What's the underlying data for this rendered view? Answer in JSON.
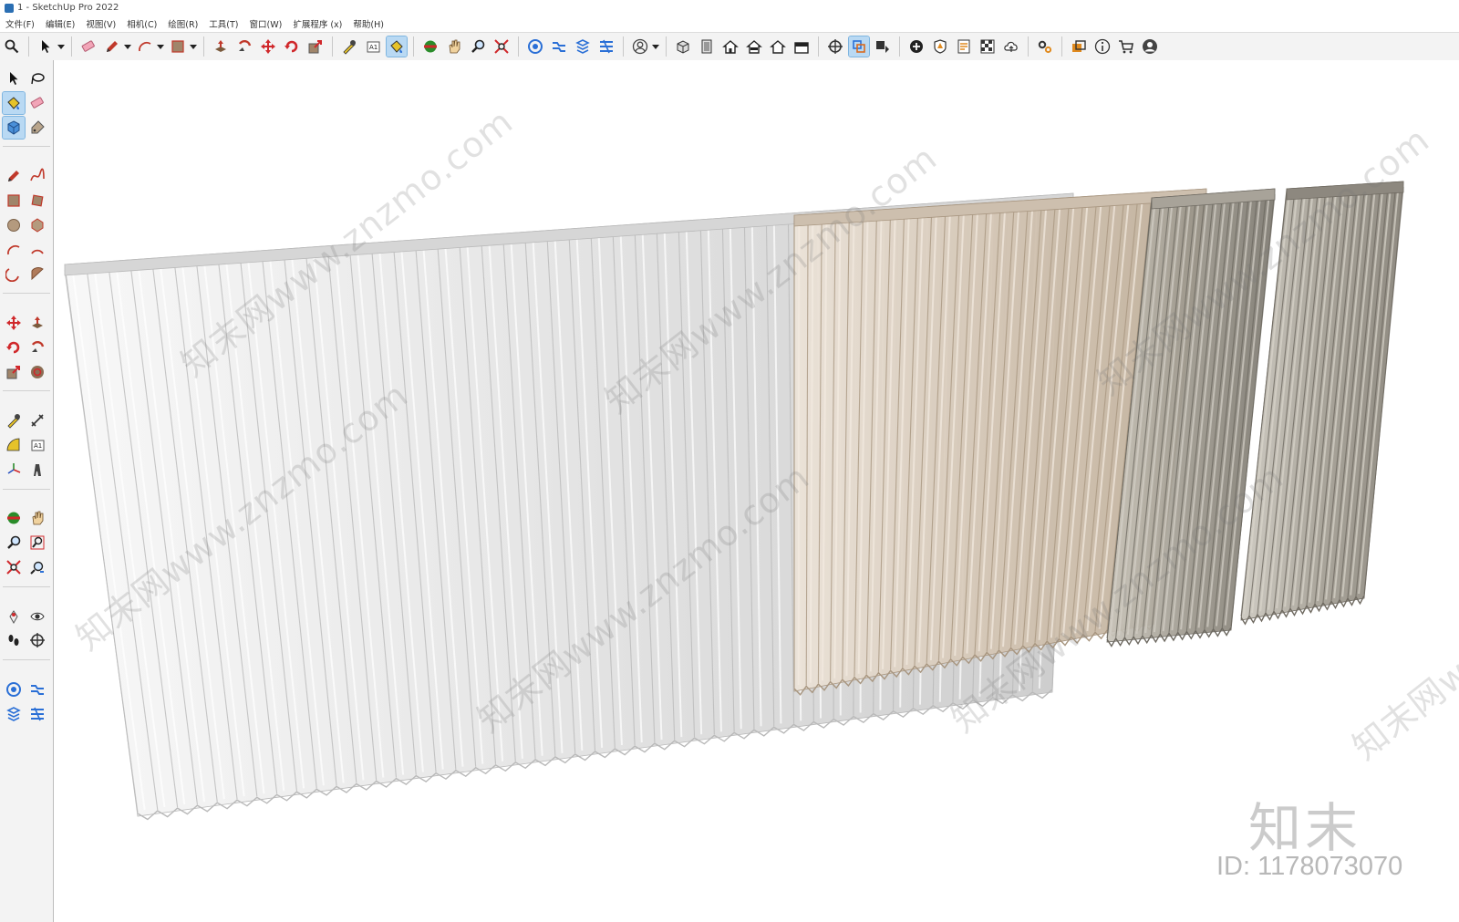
{
  "window": {
    "title": "1 - SketchUp Pro 2022"
  },
  "menu": [
    {
      "label": "文件(F)"
    },
    {
      "label": "编辑(E)"
    },
    {
      "label": "视图(V)"
    },
    {
      "label": "相机(C)"
    },
    {
      "label": "绘图(R)"
    },
    {
      "label": "工具(T)"
    },
    {
      "label": "窗口(W)"
    },
    {
      "label": "扩展程序 (x)"
    },
    {
      "label": "帮助(H)"
    }
  ],
  "toolbar_top": [
    {
      "icon": "search-icon"
    },
    {
      "sep": true
    },
    {
      "icon": "select-arrow-icon",
      "drop": true
    },
    {
      "sep": true
    },
    {
      "icon": "eraser-icon"
    },
    {
      "icon": "pencil-icon",
      "drop": true
    },
    {
      "icon": "arc-icon",
      "drop": true
    },
    {
      "icon": "rectangle-icon",
      "drop": true
    },
    {
      "sep": true
    },
    {
      "icon": "push-pull-icon"
    },
    {
      "icon": "follow-me-icon"
    },
    {
      "icon": "move-icon"
    },
    {
      "icon": "rotate-icon"
    },
    {
      "icon": "scale-icon"
    },
    {
      "sep": true
    },
    {
      "icon": "tape-measure-icon"
    },
    {
      "icon": "text-icon"
    },
    {
      "icon": "paint-bucket-icon",
      "active": true
    },
    {
      "sep": true
    },
    {
      "icon": "orbit-icon"
    },
    {
      "icon": "pan-icon"
    },
    {
      "icon": "zoom-icon"
    },
    {
      "icon": "zoom-extents-icon"
    },
    {
      "sep": true
    },
    {
      "icon": "warehouse-icon"
    },
    {
      "icon": "extension-warehouse-icon"
    },
    {
      "icon": "layout-icon"
    },
    {
      "icon": "send-to-layout-icon"
    },
    {
      "sep": true
    },
    {
      "icon": "user-account-icon",
      "drop": true
    },
    {
      "sep": true
    },
    {
      "icon": "iso-view-icon"
    },
    {
      "icon": "top-view-icon"
    },
    {
      "icon": "front-view-icon"
    },
    {
      "icon": "right-view-icon"
    },
    {
      "icon": "back-view-icon"
    },
    {
      "icon": "left-view-icon"
    },
    {
      "sep": true
    },
    {
      "icon": "section-plane-icon"
    },
    {
      "icon": "display-section-planes-icon",
      "active": true
    },
    {
      "icon": "section-fill-icon"
    },
    {
      "sep": true
    },
    {
      "icon": "add-location-icon"
    },
    {
      "icon": "toggle-terrain-icon"
    },
    {
      "icon": "photo-texture-icon"
    },
    {
      "icon": "sandbox-icon"
    },
    {
      "icon": "cloud-upload-icon"
    },
    {
      "sep": true
    },
    {
      "icon": "settings-gears-icon"
    },
    {
      "sep": true
    },
    {
      "icon": "layers-icon"
    },
    {
      "icon": "info-icon"
    },
    {
      "icon": "cart-icon"
    },
    {
      "icon": "profile-icon"
    }
  ],
  "toolbar_left": [
    {
      "icon": "select-arrow-icon"
    },
    {
      "icon": "lasso-select-icon"
    },
    {
      "icon": "paint-bucket-icon",
      "active": true
    },
    {
      "icon": "eraser-icon"
    },
    {
      "icon": "component-icon",
      "active": true
    },
    {
      "icon": "tag-icon"
    },
    {
      "sep": true
    },
    {
      "icon": "line-icon"
    },
    {
      "icon": "freehand-icon"
    },
    {
      "icon": "rectangle-icon"
    },
    {
      "icon": "rotated-rectangle-icon"
    },
    {
      "icon": "circle-icon"
    },
    {
      "icon": "polygon-icon"
    },
    {
      "icon": "arc-icon"
    },
    {
      "icon": "two-point-arc-icon"
    },
    {
      "icon": "three-point-arc-icon"
    },
    {
      "icon": "pie-icon"
    },
    {
      "sep": true
    },
    {
      "icon": "move-icon"
    },
    {
      "icon": "push-pull-icon"
    },
    {
      "icon": "rotate-icon"
    },
    {
      "icon": "follow-me-icon"
    },
    {
      "icon": "scale-icon"
    },
    {
      "icon": "offset-icon"
    },
    {
      "sep": true
    },
    {
      "icon": "tape-measure-icon"
    },
    {
      "icon": "dimension-icon"
    },
    {
      "icon": "protractor-icon"
    },
    {
      "icon": "text-icon"
    },
    {
      "icon": "axes-icon"
    },
    {
      "icon": "3d-text-icon"
    },
    {
      "sep": true
    },
    {
      "icon": "orbit-icon"
    },
    {
      "icon": "pan-icon"
    },
    {
      "icon": "zoom-icon"
    },
    {
      "icon": "zoom-window-icon"
    },
    {
      "icon": "zoom-extents-icon"
    },
    {
      "icon": "previous-view-icon"
    },
    {
      "sep": true
    },
    {
      "icon": "position-camera-icon"
    },
    {
      "icon": "look-around-icon"
    },
    {
      "icon": "walk-icon"
    },
    {
      "icon": "section-plane-icon"
    },
    {
      "sep": true
    },
    {
      "icon": "warehouse-icon"
    },
    {
      "icon": "extension-warehouse-icon"
    },
    {
      "icon": "extension-manager-icon"
    },
    {
      "icon": "send-to-layout-icon"
    }
  ],
  "watermark": {
    "site_text": "知末网www.znzmo.com",
    "logo_text": "知末",
    "id_text": "ID: 1178073070"
  },
  "scene": {
    "curtain_colors": [
      "#ececec",
      "#d9ccbd",
      "#9e9a90",
      "#a39e94"
    ]
  }
}
